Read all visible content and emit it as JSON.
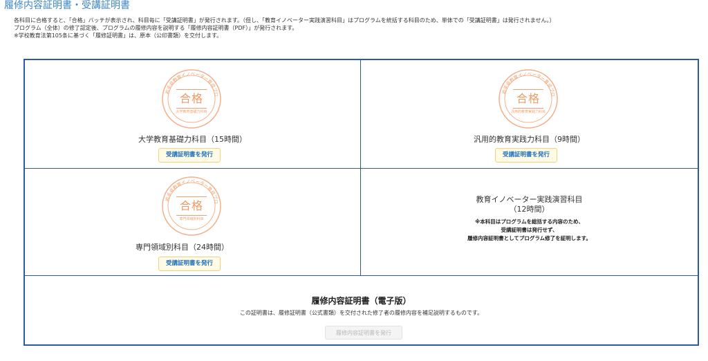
{
  "page": {
    "title": "履修内容証明書・受講証明書",
    "intro_lines": [
      "各科目に合格すると、「合格」バッチが表示され、科目毎に「受講証明書」が発行されます。（但し、「教育イノベーター実践演習科目」はプログラムを統括する科目のため、単体での「受講証明書」は発行されません。）",
      "プログラム（全体）の修了認定後、プログラムの履修内容を説明する「履修内容証明書（PDF）」が発行されます。",
      "※学校教育法第105条に基づく「履修証明書」は、原本（公印書類）を交付します。"
    ]
  },
  "seal": {
    "center": "合格",
    "ring": "岩手県教育イノベーター育成プログラム",
    "color": "#ef9a66"
  },
  "courses": [
    {
      "name": "大学教育基礎力科目（15時間）",
      "seal_sub": "大学教育基礎力科目",
      "button": "受講証明書を発行"
    },
    {
      "name": "汎用的教育実践力科目（9時間）",
      "seal_sub": "汎用的教育実践力科目",
      "button": "受講証明書を発行"
    },
    {
      "name": "専門領域別科目（24時間）",
      "seal_sub": "専門領域別科目",
      "button": "受講証明書を発行"
    }
  ],
  "innovator": {
    "title_line1": "教育イノベーター実践演習科目",
    "title_line2": "（12時間）",
    "note_line1": "※本科目はプログラムを総括する内容のため、",
    "note_line2": "受講証明書は発行せず、",
    "note_line3": "履修内容証明書としてプログラム修了を証明します。"
  },
  "document": {
    "title": "履修内容証明書（電子版）",
    "description": "この証明書は、履修証明書（公式書類）を交付された修了者の履修内容を補足説明するものです。",
    "button": "履修内容証明書を発行",
    "button_enabled": false
  },
  "colors": {
    "title": "#3d85c6",
    "border": "#2c5aa0",
    "button_bg": "#fffbe5",
    "button_text": "#1e6fbf"
  }
}
